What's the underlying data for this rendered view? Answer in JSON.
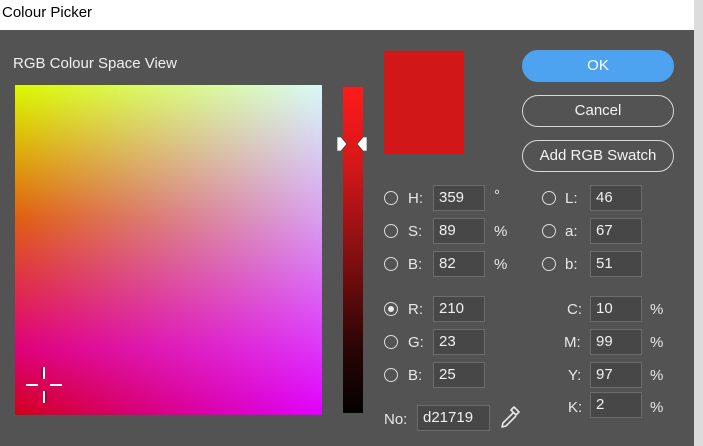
{
  "window": {
    "title": "Colour Picker"
  },
  "view": {
    "label": "RGB Colour Space View"
  },
  "current_color": "#d21719",
  "buttons": {
    "ok": "OK",
    "cancel": "Cancel",
    "add_swatch": "Add RGB Swatch"
  },
  "hsb": [
    {
      "label": "H:",
      "value": "359",
      "unit": "°",
      "selected": false
    },
    {
      "label": "S:",
      "value": "89",
      "unit": "%",
      "selected": false
    },
    {
      "label": "B:",
      "value": "82",
      "unit": "%",
      "selected": false
    }
  ],
  "rgb": [
    {
      "label": "R:",
      "value": "210",
      "selected": true
    },
    {
      "label": "G:",
      "value": "23",
      "selected": false
    },
    {
      "label": "B:",
      "value": "25",
      "selected": false
    }
  ],
  "lab": [
    {
      "label": "L:",
      "value": "46"
    },
    {
      "label": "a:",
      "value": "67"
    },
    {
      "label": "b:",
      "value": "51"
    }
  ],
  "cmyk": [
    {
      "label": "C:",
      "value": "10",
      "unit": "%"
    },
    {
      "label": "M:",
      "value": "99",
      "unit": "%"
    },
    {
      "label": "Y:",
      "value": "97",
      "unit": "%"
    },
    {
      "label": "K:",
      "value": "2",
      "unit": "%"
    }
  ],
  "hex": {
    "label": "No:",
    "value": "d21719"
  },
  "icons": {
    "eyedropper": "eyedropper-icon",
    "crosshair": "crosshair-cursor-icon"
  }
}
